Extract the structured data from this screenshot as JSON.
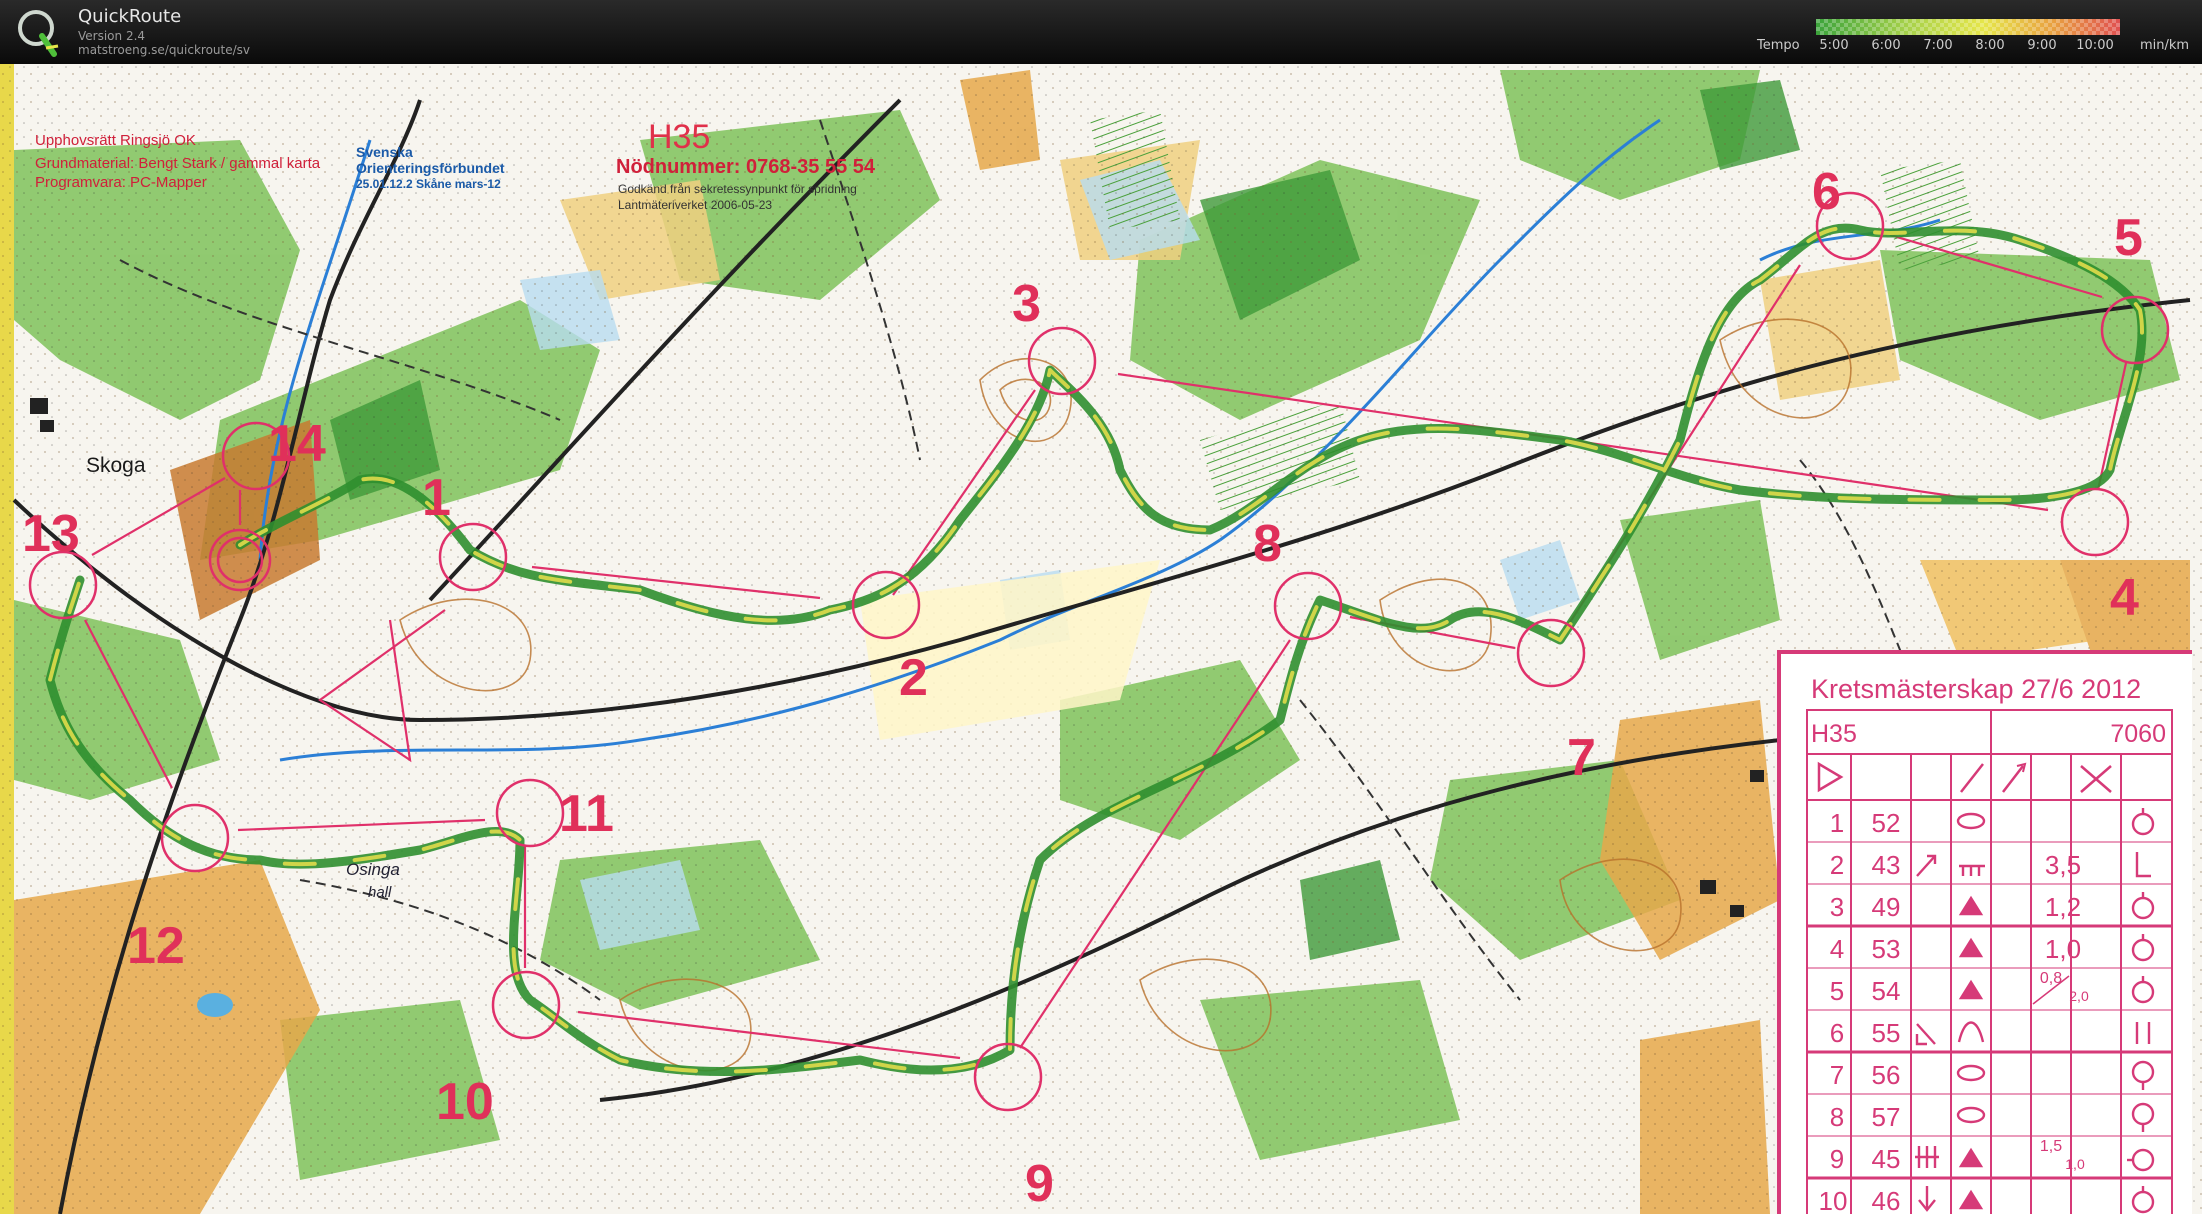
{
  "app": {
    "title": "QuickRoute",
    "version": "Version 2.4",
    "url": "matstroeng.se/quickroute/sv",
    "logo_icon": "quickroute-q-logo"
  },
  "tempo": {
    "label": "Tempo",
    "ticks": [
      "5:00",
      "6:00",
      "7:00",
      "8:00",
      "9:00",
      "10:00"
    ],
    "unit": "min/km",
    "colors": [
      "#3ba33b",
      "#a6d14a",
      "#e6e64a",
      "#e8a040",
      "#e05050"
    ]
  },
  "map": {
    "copyright": "Upphovsrätt Ringsjö OK",
    "base_material": "Grundmaterial: Bengt Stark / gammal karta",
    "software": "Programvara: PC-Mapper",
    "sof_line1": "Svenska",
    "sof_line2": "Orienteringsförbundet",
    "sof_line3": "25.01.12.2 Skåne mars-12",
    "class_code": "H35",
    "emergency": "Nödnummer: 0768-35 55 54",
    "approval_line1": "Godkänd från sekretessynpunkt för spridning",
    "approval_line2": "Lantmäteriverket 2006-05-23",
    "places": {
      "skoga": "Skoga",
      "osinga": "Osinga",
      "osinga_hall": "hall"
    },
    "controls": [
      "1",
      "2",
      "3",
      "4",
      "5",
      "6",
      "7",
      "8",
      "9",
      "10",
      "11",
      "12",
      "13",
      "14"
    ]
  },
  "card": {
    "title": "Kretsmästerskap 27/6 2012",
    "class": "H35",
    "length": "7060",
    "rows": [
      {
        "num": "1",
        "code": "52",
        "dist": ""
      },
      {
        "num": "2",
        "code": "43",
        "dist": "3,5"
      },
      {
        "num": "3",
        "code": "49",
        "dist": "1,2"
      },
      {
        "num": "4",
        "code": "53",
        "dist": "1,0"
      },
      {
        "num": "5",
        "code": "54",
        "dist": "0,8"
      },
      {
        "num": "6",
        "code": "55",
        "dist": ""
      },
      {
        "num": "7",
        "code": "56",
        "dist": ""
      },
      {
        "num": "8",
        "code": "57",
        "dist": ""
      },
      {
        "num": "9",
        "code": "45",
        "dist": "1,5"
      },
      {
        "num": "10",
        "code": "46",
        "dist": ""
      }
    ],
    "extra_dims": {
      "r5": "2,0",
      "r9": "1,0"
    },
    "accent": "#d63a78"
  }
}
